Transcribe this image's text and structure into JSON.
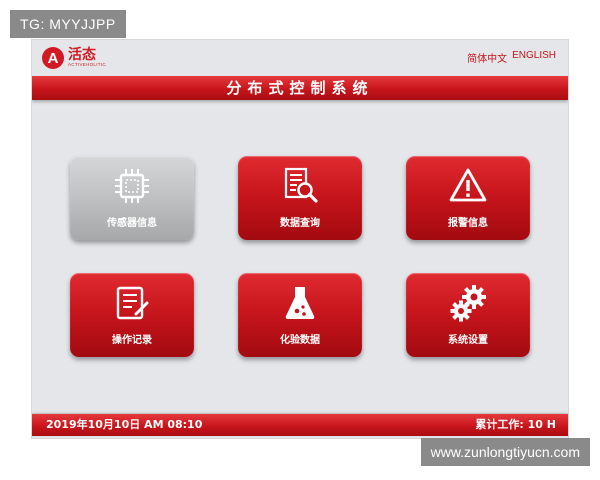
{
  "watermarks": {
    "top_left": "TG: MYYJJPP",
    "bottom_right": "www.zunlongtiyucn.com"
  },
  "header": {
    "logo_mark": "A",
    "logo_cn": "活态",
    "logo_en": "ACTIVEHOLITIC",
    "lang_cn": "简体中文",
    "lang_en": "ENGLISH"
  },
  "title": "分布式控制系统",
  "tiles": [
    {
      "label": "传感器信息",
      "icon": "chip-icon",
      "active": true
    },
    {
      "label": "数据查询",
      "icon": "document-search-icon",
      "active": false
    },
    {
      "label": "报警信息",
      "icon": "warning-icon",
      "active": false
    },
    {
      "label": "操作记录",
      "icon": "notepad-pencil-icon",
      "active": false
    },
    {
      "label": "化验数据",
      "icon": "flask-icon",
      "active": false
    },
    {
      "label": "系统设置",
      "icon": "gears-icon",
      "active": false
    }
  ],
  "footer": {
    "datetime": "2019年10月10日  AM 08:10",
    "worktime": "累计工作: 10 H"
  },
  "colors": {
    "accent": "#c8151c",
    "background": "#e4e6e9",
    "inactive_tile": "#bfc0c2"
  }
}
